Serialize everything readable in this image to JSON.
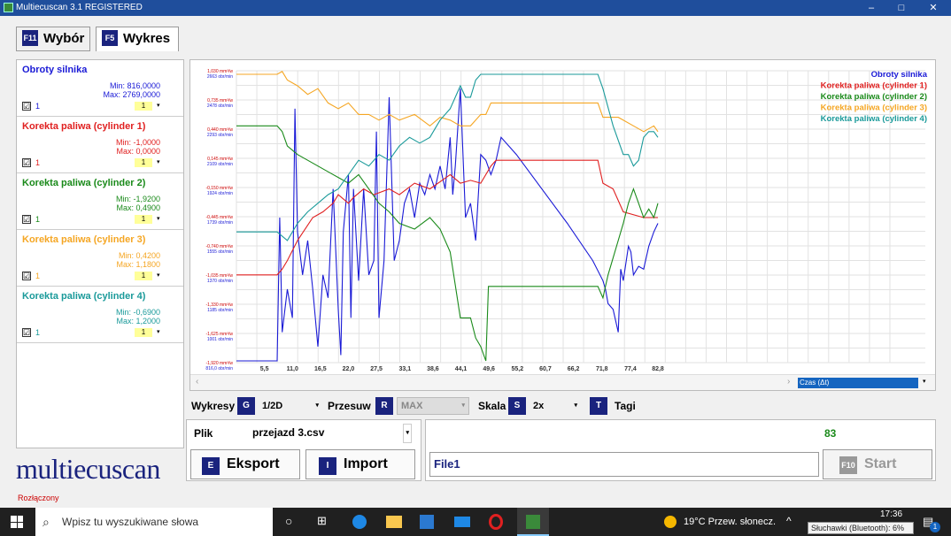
{
  "window": {
    "title": "Multiecuscan 3.1 REGISTERED",
    "min": "–",
    "max": "□",
    "close": "✕"
  },
  "tabs": [
    {
      "key": "F11",
      "label": "Wybór"
    },
    {
      "key": "F5",
      "label": "Wykres"
    }
  ],
  "channels": [
    {
      "name": "Obroty silnika",
      "min": "Min: 816,0000",
      "max": "Max: 2769,0000",
      "color": "#1a1ad6",
      "check": "☑",
      "num": "1",
      "sel": "1"
    },
    {
      "name": "Korekta paliwa (cylinder 1)",
      "min": "Min: -1,0000",
      "max": "Max: 0,0000",
      "color": "#e02020",
      "check": "☑",
      "num": "1",
      "sel": "1"
    },
    {
      "name": "Korekta paliwa (cylinder 2)",
      "min": "Min: -1,9200",
      "max": "Max: 0,4900",
      "color": "#1a8a1a",
      "check": "☑",
      "num": "1",
      "sel": "1"
    },
    {
      "name": "Korekta paliwa (cylinder 3)",
      "min": "Min: 0,4200",
      "max": "Max: 1,1800",
      "color": "#f5a623",
      "check": "☑",
      "num": "1",
      "sel": "1"
    },
    {
      "name": "Korekta paliwa (cylinder 4)",
      "min": "Min: -0,6900",
      "max": "Max: 1,2000",
      "color": "#1a9a9a",
      "check": "☑",
      "num": "1",
      "sel": "1"
    }
  ],
  "chart_data": {
    "type": "line",
    "x_ticks": [
      "5,5",
      "11,0",
      "16,5",
      "22,0",
      "27,5",
      "33,1",
      "38,6",
      "44,1",
      "49,6",
      "55,2",
      "60,7",
      "66,2",
      "71,8",
      "77,4",
      "82,8"
    ],
    "y_ticks": [
      {
        "a": "1,030 mm³/w",
        "b": "2663 obr/min"
      },
      {
        "a": "0,735 mm³/w",
        "b": "2478 obr/min"
      },
      {
        "a": "0,440 mm³/w",
        "b": "2293 obr/min"
      },
      {
        "a": "0,145 mm³/w",
        "b": "2109 obr/min"
      },
      {
        "a": "-0,150 mm³/w",
        "b": "1924 obr/min"
      },
      {
        "a": "-0,445 mm³/w",
        "b": "1739 obr/min"
      },
      {
        "a": "-0,740 mm³/w",
        "b": "1555 obr/min"
      },
      {
        "a": "-1,035 mm³/w",
        "b": "1370 obr/min"
      },
      {
        "a": "-1,330 mm³/w",
        "b": "1185 obr/min"
      },
      {
        "a": "-1,625 mm³/w",
        "b": "1001 obr/min"
      },
      {
        "a": "-1,920 mm³/w",
        "b": "816,0 obr/min"
      }
    ],
    "x_axis_selector": "Czas (Δt)",
    "legend": [
      "Obroty silnika",
      "Korekta paliwa (cylinder 1)",
      "Korekta paliwa (cylinder 2)",
      "Korekta paliwa (cylinder 3)",
      "Korekta paliwa (cylinder 4)"
    ],
    "legend_position": "top-right",
    "grid": true,
    "series": [
      {
        "name": "Obroty silnika",
        "color": "#1a1ad6",
        "points": [
          [
            0,
            0.0
          ],
          [
            8,
            0.0
          ],
          [
            8.5,
            0.5
          ],
          [
            9,
            0.1
          ],
          [
            10,
            0.25
          ],
          [
            11,
            0.15
          ],
          [
            11.5,
            0.88
          ],
          [
            12,
            0.45
          ],
          [
            13,
            0.3
          ],
          [
            14,
            0.42
          ],
          [
            15,
            0.25
          ],
          [
            16,
            0.05
          ],
          [
            17,
            0.3
          ],
          [
            18,
            0.22
          ],
          [
            19,
            0.6
          ],
          [
            20,
            0.18
          ],
          [
            20.5,
            0.02
          ],
          [
            21,
            0.45
          ],
          [
            22,
            0.65
          ],
          [
            22.5,
            0.15
          ],
          [
            23,
            0.6
          ],
          [
            24,
            0.28
          ],
          [
            25,
            0.6
          ],
          [
            26,
            0.3
          ],
          [
            27,
            0.35
          ],
          [
            27.5,
            0.8
          ],
          [
            28,
            0.15
          ],
          [
            29,
            0.35
          ],
          [
            30,
            0.92
          ],
          [
            31,
            0.35
          ],
          [
            32,
            0.42
          ],
          [
            33,
            0.55
          ],
          [
            34,
            0.6
          ],
          [
            35,
            0.5
          ],
          [
            36,
            0.62
          ],
          [
            37,
            0.58
          ],
          [
            38,
            0.65
          ],
          [
            39,
            0.6
          ],
          [
            40,
            0.68
          ],
          [
            41,
            0.6
          ],
          [
            42,
            0.78
          ],
          [
            42.5,
            0.58
          ],
          [
            43,
            0.68
          ],
          [
            44,
            0.95
          ],
          [
            45,
            0.5
          ],
          [
            46,
            0.55
          ],
          [
            47,
            0.42
          ],
          [
            48,
            0.72
          ],
          [
            49,
            0.7
          ],
          [
            50,
            0.65
          ],
          [
            51,
            0.7
          ],
          [
            52,
            0.78
          ],
          [
            55,
            0.72
          ],
          [
            60,
            0.6
          ],
          [
            65,
            0.48
          ],
          [
            70,
            0.35
          ],
          [
            72,
            0.28
          ],
          [
            72.5,
            0.25
          ],
          [
            73,
            0.2
          ],
          [
            74,
            0.18
          ],
          [
            75,
            0.1
          ],
          [
            75.5,
            0.32
          ],
          [
            76,
            0.28
          ],
          [
            77,
            0.4
          ],
          [
            77.5,
            0.38
          ],
          [
            78,
            0.3
          ],
          [
            79,
            0.33
          ],
          [
            80,
            0.32
          ],
          [
            81,
            0.4
          ],
          [
            82,
            0.45
          ],
          [
            82.8,
            0.48
          ]
        ]
      },
      {
        "name": "Korekta paliwa (cylinder 1)",
        "color": "#e02020",
        "points": [
          [
            0,
            0.3
          ],
          [
            8,
            0.3
          ],
          [
            9,
            0.32
          ],
          [
            10,
            0.35
          ],
          [
            12,
            0.42
          ],
          [
            15,
            0.5
          ],
          [
            17,
            0.52
          ],
          [
            19,
            0.55
          ],
          [
            20,
            0.58
          ],
          [
            22,
            0.55
          ],
          [
            23,
            0.57
          ],
          [
            25,
            0.6
          ],
          [
            27,
            0.58
          ],
          [
            30,
            0.6
          ],
          [
            32,
            0.58
          ],
          [
            35,
            0.62
          ],
          [
            38,
            0.6
          ],
          [
            42,
            0.65
          ],
          [
            44,
            0.62
          ],
          [
            46,
            0.63
          ],
          [
            48,
            0.62
          ],
          [
            50,
            0.68
          ],
          [
            51,
            0.7
          ],
          [
            66,
            0.7
          ],
          [
            71,
            0.7
          ],
          [
            72,
            0.62
          ],
          [
            74,
            0.6
          ],
          [
            76,
            0.52
          ],
          [
            80,
            0.5
          ],
          [
            82.8,
            0.5
          ]
        ]
      },
      {
        "name": "Korekta paliwa (cylinder 2)",
        "color": "#1a8a1a",
        "points": [
          [
            0,
            0.82
          ],
          [
            8,
            0.82
          ],
          [
            9,
            0.8
          ],
          [
            10,
            0.75
          ],
          [
            12,
            0.72
          ],
          [
            14,
            0.7
          ],
          [
            16,
            0.68
          ],
          [
            18,
            0.66
          ],
          [
            20,
            0.64
          ],
          [
            22,
            0.62
          ],
          [
            24,
            0.65
          ],
          [
            26,
            0.6
          ],
          [
            28,
            0.55
          ],
          [
            30,
            0.52
          ],
          [
            32,
            0.48
          ],
          [
            35,
            0.46
          ],
          [
            38,
            0.5
          ],
          [
            40,
            0.46
          ],
          [
            42,
            0.38
          ],
          [
            44,
            0.15
          ],
          [
            46,
            0.15
          ],
          [
            47,
            0.08
          ],
          [
            48,
            0.05
          ],
          [
            49,
            0.0
          ],
          [
            49.5,
            0.26
          ],
          [
            50,
            0.26
          ],
          [
            71,
            0.26
          ],
          [
            72,
            0.22
          ],
          [
            73,
            0.3
          ],
          [
            75,
            0.42
          ],
          [
            76,
            0.48
          ],
          [
            77,
            0.55
          ],
          [
            78,
            0.6
          ],
          [
            79,
            0.55
          ],
          [
            80,
            0.5
          ],
          [
            81,
            0.53
          ],
          [
            82,
            0.5
          ],
          [
            82.8,
            0.55
          ]
        ]
      },
      {
        "name": "Korekta paliwa (cylinder 3)",
        "color": "#f5a623",
        "points": [
          [
            0,
            1.0
          ],
          [
            8,
            1.0
          ],
          [
            9,
            1.01
          ],
          [
            10,
            0.98
          ],
          [
            12,
            0.96
          ],
          [
            14,
            0.93
          ],
          [
            16,
            0.95
          ],
          [
            18,
            0.9
          ],
          [
            20,
            0.88
          ],
          [
            22,
            0.9
          ],
          [
            24,
            0.86
          ],
          [
            26,
            0.86
          ],
          [
            28,
            0.84
          ],
          [
            30,
            0.86
          ],
          [
            32,
            0.84
          ],
          [
            35,
            0.86
          ],
          [
            38,
            0.82
          ],
          [
            40,
            0.85
          ],
          [
            42,
            0.84
          ],
          [
            44,
            0.82
          ],
          [
            46,
            0.82
          ],
          [
            48,
            0.86
          ],
          [
            49,
            0.86
          ],
          [
            50,
            0.9
          ],
          [
            71,
            0.9
          ],
          [
            72,
            0.85
          ],
          [
            75,
            0.85
          ],
          [
            78,
            0.82
          ],
          [
            80,
            0.8
          ],
          [
            82,
            0.82
          ],
          [
            82.8,
            0.8
          ]
        ]
      },
      {
        "name": "Korekta paliwa (cylinder 4)",
        "color": "#1a9a9a",
        "points": [
          [
            0,
            0.45
          ],
          [
            8,
            0.45
          ],
          [
            10,
            0.42
          ],
          [
            12,
            0.48
          ],
          [
            14,
            0.52
          ],
          [
            16,
            0.55
          ],
          [
            18,
            0.58
          ],
          [
            20,
            0.6
          ],
          [
            22,
            0.65
          ],
          [
            24,
            0.7
          ],
          [
            26,
            0.68
          ],
          [
            28,
            0.72
          ],
          [
            30,
            0.7
          ],
          [
            32,
            0.75
          ],
          [
            34,
            0.78
          ],
          [
            36,
            0.76
          ],
          [
            38,
            0.78
          ],
          [
            40,
            0.84
          ],
          [
            41,
            0.86
          ],
          [
            42,
            0.88
          ],
          [
            44,
            0.96
          ],
          [
            45,
            0.92
          ],
          [
            46,
            0.92
          ],
          [
            47,
            0.98
          ],
          [
            48,
            1.0
          ],
          [
            70,
            1.0
          ],
          [
            71,
            1.0
          ],
          [
            72,
            0.95
          ],
          [
            74,
            0.82
          ],
          [
            76,
            0.72
          ],
          [
            77,
            0.72
          ],
          [
            78,
            0.68
          ],
          [
            79,
            0.7
          ],
          [
            80,
            0.78
          ],
          [
            81,
            0.8
          ],
          [
            82,
            0.8
          ],
          [
            82.8,
            0.78
          ]
        ]
      }
    ]
  },
  "controls": {
    "wykresy": "Wykresy",
    "wykresy_key": "G",
    "wykresy_val": "1/2D",
    "przesuw": "Przesuw",
    "przesuw_key": "R",
    "przesuw_val": "MAX",
    "skala": "Skala",
    "skala_key": "S",
    "skala_val": "2x",
    "tagi_key": "T",
    "tagi": "Tagi"
  },
  "file": {
    "label": "Plik",
    "value": "przejazd 3.csv",
    "eksport_key": "E",
    "eksport": "Eksport",
    "import_key": "I",
    "import": "Import"
  },
  "right_box": {
    "count": "83",
    "file_field": "File1",
    "start_key": "F10",
    "start": "Start"
  },
  "logo": "multiecuscan",
  "status": "Rozłączony",
  "taskbar": {
    "search": "Wpisz tu wyszukiwane słowa",
    "weather": "19°C  Przew. słonecz.",
    "time": "17:36",
    "tooltip": "Słuchawki (Bluetooth): 6%",
    "notif": "1"
  }
}
